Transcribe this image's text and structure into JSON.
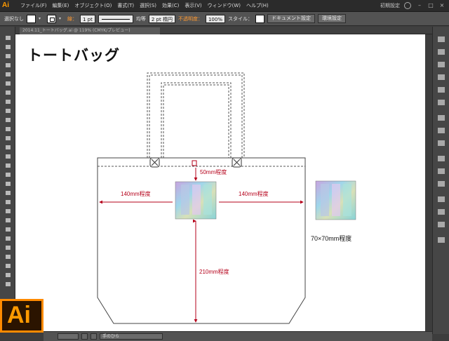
{
  "menubar": {
    "logo": "Ai",
    "items": [
      "ファイル(F)",
      "編集(E)",
      "オブジェクト(O)",
      "書式(T)",
      "選択(S)",
      "効果(C)",
      "表示(V)",
      "ウィンドウ(W)",
      "ヘルプ(H)"
    ],
    "workspace": "初期設定"
  },
  "controlbar": {
    "selection": "選択なし",
    "stroke_label": "線：",
    "stroke_weight": "1 pt",
    "stroke_profile": "均等",
    "brush": "2 pt 楕円",
    "opacity_label": "不透明度：",
    "opacity": "100%",
    "style_label": "スタイル：",
    "doc_settings": "ドキュメント設定",
    "prefs": "環境設定"
  },
  "doc_tab": {
    "name": "2014.11_トートバッグ.ai @ 119% (CMYK/プレビュー)"
  },
  "artboard": {
    "title": "トートバッグ",
    "dims": {
      "top": "50mm程度",
      "left": "140mm程度",
      "right": "140mm程度",
      "bottom": "210mm程度"
    },
    "sample_size": "70×70mm程度"
  },
  "statusbar": {
    "tool": "手のひら"
  },
  "colors": {
    "dimension": "#b5001a",
    "accent": "#ff9a00",
    "hologram_a": "#c7a4e0",
    "hologram_b": "#88d4d8"
  },
  "logo": "Ai"
}
